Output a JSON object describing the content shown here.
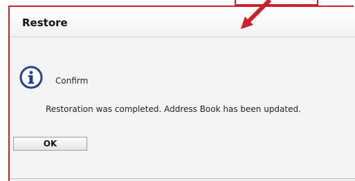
{
  "dialog": {
    "title": "Restore",
    "confirm_label": "Confirm",
    "message": "Restoration was completed. Address Book has been updated.",
    "ok_button_label": "OK"
  },
  "icons": {
    "info": "info-icon",
    "annotation": "red-arrow-icon"
  },
  "colors": {
    "annotation_red": "#cc1f2b",
    "info_blue": "#1f3f8f",
    "dialog_background": "#f4f4f4"
  }
}
